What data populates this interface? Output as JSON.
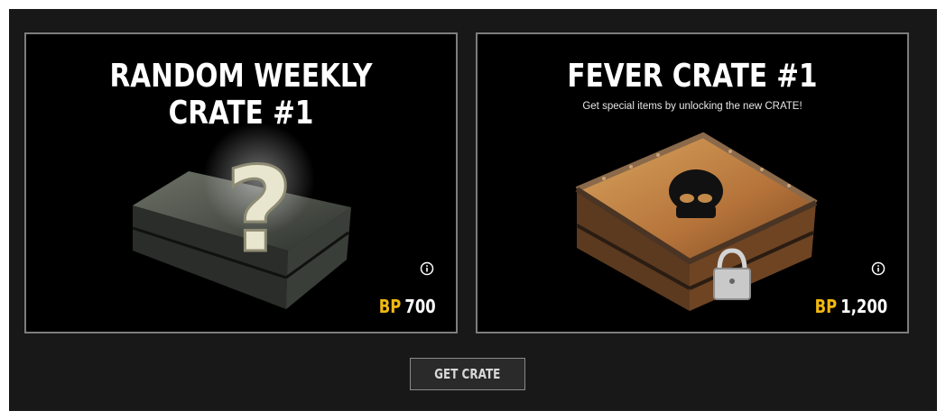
{
  "crates": [
    {
      "title": "RANDOM WEEKLY CRATE #1",
      "subtitle": "",
      "currency": "BP",
      "price": "700",
      "icon": "question-mark-crate-icon"
    },
    {
      "title": "FEVER CRATE #1",
      "subtitle": "Get special items by unlocking the new CRATE!",
      "currency": "BP",
      "price": "1,200",
      "icon": "locked-crate-icon"
    }
  ],
  "actions": {
    "get_crate_label": "GET CRATE"
  },
  "colors": {
    "currency_accent": "#f2b90f",
    "card_border": "#7d7d7d",
    "panel_background": "#181818"
  }
}
